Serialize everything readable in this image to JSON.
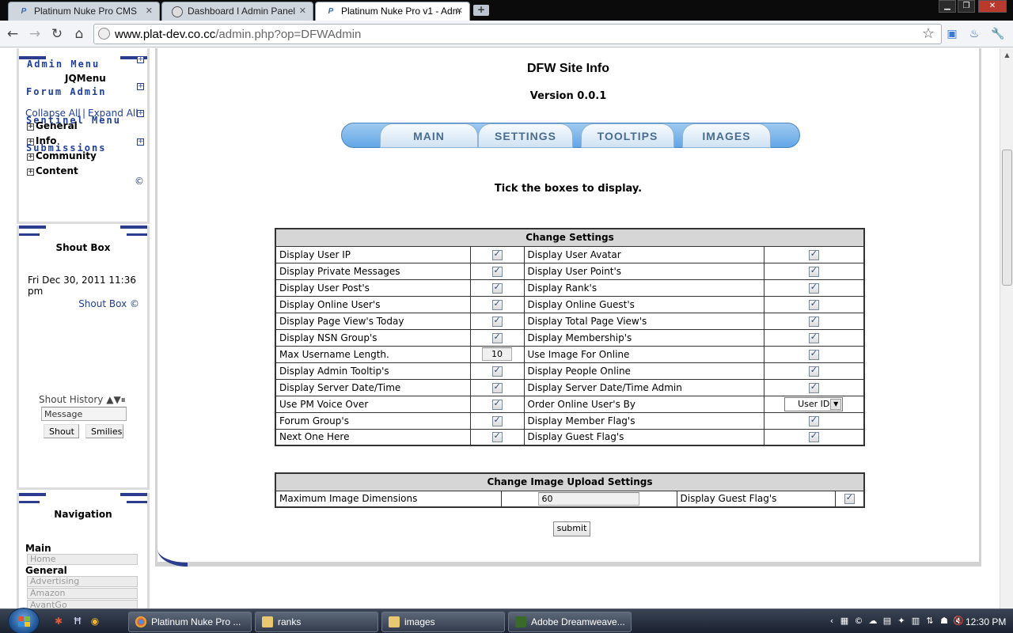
{
  "browser": {
    "tabs": [
      {
        "title": "Platinum Nuke Pro CMS",
        "icon": "platinum-p-icon"
      },
      {
        "title": "Dashboard I Admin Panel",
        "icon": "globe-icon"
      },
      {
        "title": "Platinum Nuke Pro v1 - Adm",
        "icon": "platinum-p-icon"
      }
    ],
    "url_host": "www.plat-dev.co.cc",
    "url_path": "/admin.php?op=DFWAdmin"
  },
  "sidebar": {
    "admin_block": {
      "admin_menu": "Admin Menu",
      "jqmenu": "JQMenu",
      "forum_admin": "Forum Admin",
      "collapse_all": "Collapse All",
      "separator": "|",
      "expand_all": "Expand All",
      "sentinel_menu": "Sentinel Menu",
      "submissions": "Submissions",
      "items": [
        "General",
        "Info",
        "Community",
        "Content"
      ],
      "copyright": "©"
    },
    "shoutbox": {
      "title": "Shout Box",
      "date": "Fri Dec 30, 2011 11:36 pm",
      "link": "Shout Box ©",
      "history": "Shout History",
      "message_value": "Message",
      "shout_label": "Shout",
      "smilies_label": "Smilies"
    },
    "navigation": {
      "title": "Navigation",
      "main_heading": "Main",
      "home": "Home",
      "general_heading": "General",
      "links": [
        "Advertising",
        "Amazon",
        "AvantGo"
      ]
    }
  },
  "main": {
    "title": "DFW Site Info",
    "version": "Version 0.0.1",
    "tabs": [
      "MAIN",
      "SETTINGS",
      "TOOLTIPS",
      "IMAGES"
    ],
    "instruction": "Tick the boxes to display.",
    "settings_table": {
      "header": "Change Settings",
      "rows": [
        {
          "left": "Display User IP",
          "right": "Display User Avatar"
        },
        {
          "left": "Display Private Messages",
          "right": "Display User Point's"
        },
        {
          "left": "Display User Post's",
          "right": "Display Rank's"
        },
        {
          "left": "Display Online User's",
          "right": "Display Online Guest's"
        },
        {
          "left": "Display Page View's Today",
          "right": "Display Total Page View's"
        },
        {
          "left": "Display NSN Group's",
          "right": "Display Membership's"
        },
        {
          "left": "Max Username Length.",
          "left_value": "10",
          "right": "Use Image For Online"
        },
        {
          "left": "Display Admin Tooltip's",
          "right": "Display People Online"
        },
        {
          "left": "Display Server Date/Time",
          "right": "Display Server Date/Time Admin"
        },
        {
          "left": "Use PM Voice Over",
          "right": "Order Online User's By",
          "right_select": "User ID"
        },
        {
          "left": "Forum Group's",
          "right": "Display Member Flag's"
        },
        {
          "left": "Next One Here",
          "right": "Display Guest Flag's"
        }
      ]
    },
    "image_table": {
      "header": "Change Image Upload Settings",
      "label": "Maximum Image Dimensions",
      "value": "60",
      "right_label": "Display Guest Flag's"
    },
    "submit_label": "submit"
  },
  "taskbar": {
    "tasks": [
      "Platinum Nuke Pro ...",
      "ranks",
      "images",
      "Adobe Dreamweave..."
    ],
    "clock": "12:30 PM"
  }
}
